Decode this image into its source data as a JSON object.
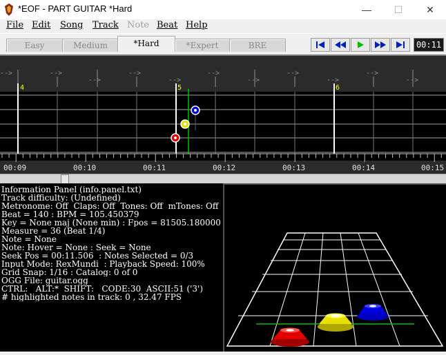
{
  "window": {
    "title": "*EOF - PART GUITAR  *Hard",
    "minimize": "—",
    "maximize": "☐",
    "close": "✕"
  },
  "menu": {
    "items": [
      {
        "label": "File",
        "enabled": true
      },
      {
        "label": "Edit",
        "enabled": true
      },
      {
        "label": "Song",
        "enabled": true
      },
      {
        "label": "Track",
        "enabled": true
      },
      {
        "label": "Note",
        "enabled": false
      },
      {
        "label": "Beat",
        "enabled": true
      },
      {
        "label": "Help",
        "enabled": true
      }
    ]
  },
  "difficulty_tabs": [
    {
      "label": "Easy",
      "active": false
    },
    {
      "label": "Medium",
      "active": false
    },
    {
      "label": "*Hard",
      "active": true
    },
    {
      "label": "*Expert",
      "active": false
    },
    {
      "label": "BRE",
      "active": false
    }
  ],
  "transport": {
    "buttons": [
      "skip-to-start-icon",
      "rewind-icon",
      "play-icon",
      "fast-forward-icon",
      "skip-to-end-icon"
    ],
    "time": "00:11"
  },
  "timeline": {
    "measure_markers": [
      "4",
      "5",
      "6"
    ],
    "time_labels": [
      "00:09",
      "00:10",
      "00:11",
      "00:12",
      "00:13",
      "00:14",
      "00:15"
    ],
    "beat_arrow": "-->",
    "notes": [
      {
        "lane": 1,
        "color": "#e00000"
      },
      {
        "lane": 2,
        "color": "#e8e000"
      },
      {
        "lane": 3,
        "color": "#0000e0"
      }
    ]
  },
  "info_panel": {
    "title": "Information Panel",
    "title_suffix": " (info.panel.txt)",
    "lines": [
      "Track difficulty: (Undefined)",
      "Metronome: Off  Claps: Off  Tones: Off  mTones: Off",
      "Beat = 140 : BPM = 105.450379",
      "Key = None maj (None min) : Fpos = 81505.180000",
      "Measure = 36 (Beat 1/4)",
      "Note = None",
      "Note: Hover = None : Seek = None",
      "Seek Pos = 00:11.506  : Notes Selected = 0/3",
      "Input Mode: RexMundi  : Playback Speed: 100%",
      "Grid Snap: 1/16 : Catalog: 0 of 0",
      "OGG File: guitar.ogg",
      "CTRL:   ALT:*  SHIFT:   CODE:30  ASCII:51 ('3')",
      "# highlighted notes in track: 0 , 32.47 FPS"
    ]
  },
  "colors": {
    "green_note": "#00c000",
    "red_note": "#e00000",
    "yellow_note": "#e8e000",
    "blue_note": "#0000e0",
    "measure_marker": "#ffff00"
  }
}
